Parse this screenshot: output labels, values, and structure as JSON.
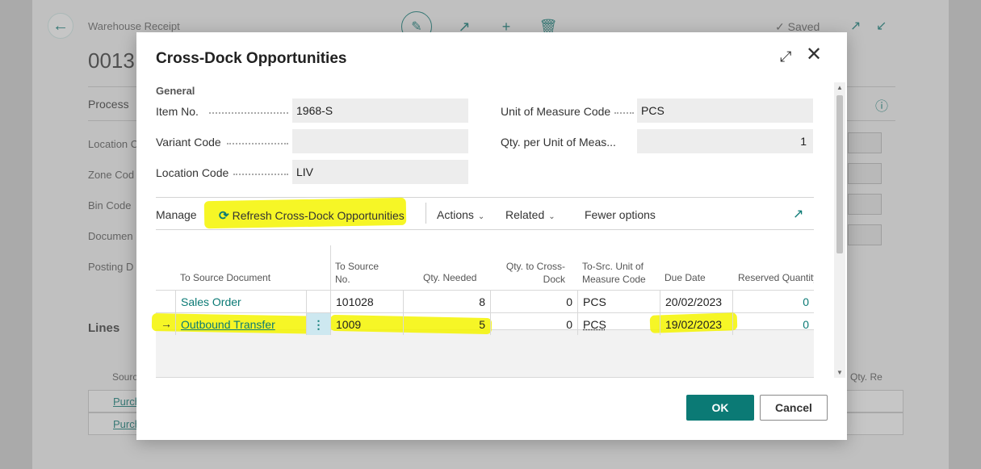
{
  "background": {
    "caption": "Warehouse Receipt",
    "doc_no": "0013",
    "saved_label": "Saved",
    "process_tab": "Process",
    "fields": [
      "Location C",
      "Zone Cod",
      "Bin Code",
      "Documen",
      "Posting D"
    ],
    "lines_label": "Lines",
    "grid_head": "Sourc",
    "row1": "Purch",
    "row2": "Purch",
    "qty_head": "Qty. Re"
  },
  "dialog": {
    "title": "Cross-Dock Opportunities",
    "section": "General",
    "fields": {
      "item_no": {
        "label": "Item No.",
        "value": "1968-S"
      },
      "variant_code": {
        "label": "Variant Code",
        "value": ""
      },
      "location_code": {
        "label": "Location Code",
        "value": "LIV"
      },
      "uom_code": {
        "label": "Unit of Measure Code",
        "value": "PCS"
      },
      "qty_per_uom": {
        "label": "Qty. per Unit of Meas...",
        "value": "1"
      }
    },
    "actions": {
      "manage": "Manage",
      "refresh": "Refresh Cross-Dock Opportunities",
      "actions": "Actions",
      "related": "Related",
      "fewer": "Fewer options"
    },
    "columns": {
      "to_source_document": "To Source Document",
      "to_source_no_1": "To Source",
      "to_source_no_2": "No.",
      "qty_needed": "Qty. Needed",
      "qty_to_cross_1": "Qty. to Cross-",
      "qty_to_cross_2": "Dock",
      "to_src_uom_1": "To-Src. Unit of",
      "to_src_uom_2": "Measure Code",
      "due_date": "Due Date",
      "reserved_qty": "Reserved Quantity"
    },
    "rows": [
      {
        "doc": "Sales Order",
        "no": "101028",
        "qty_needed": "8",
        "qty_cross": "0",
        "uom": "PCS",
        "due": "20/02/2023",
        "reserved": "0"
      },
      {
        "doc": "Outbound Transfer",
        "no": "1009",
        "qty_needed": "5",
        "qty_cross": "0",
        "uom": "PCS",
        "due": "19/02/2023",
        "reserved": "0"
      }
    ],
    "ok_label": "OK",
    "cancel_label": "Cancel",
    "highlight_color": "#f5f400",
    "accent_color": "#0b7a75"
  }
}
